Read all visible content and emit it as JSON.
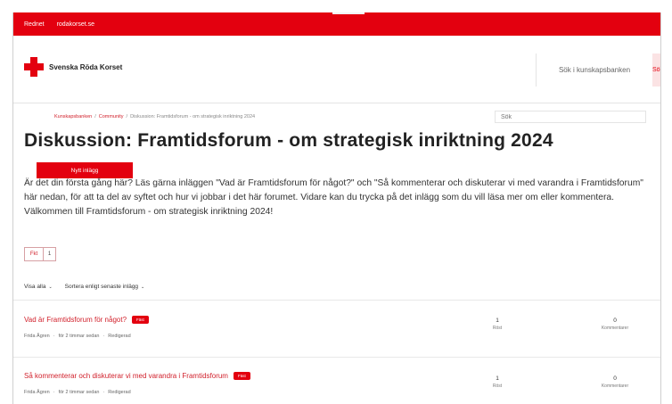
{
  "topbar": {
    "links": [
      "Rednet",
      "rodakorset.se"
    ],
    "color": "#e3000f"
  },
  "header": {
    "logo_text": "Svenska Röda Korset",
    "search_placeholder": "Sök i kunskapsbanken",
    "search_button": "Sök"
  },
  "breadcrumb": {
    "items": [
      "Kunskapsbanken",
      "Community",
      "Diskussion: Framtidsforum - om strategisk inriktning 2024"
    ],
    "separator": "/"
  },
  "side_search": {
    "placeholder": "Sök"
  },
  "page": {
    "title": "Diskussion: Framtidsforum - om strategisk inriktning 2024",
    "new_post_button": "Nytt inlägg",
    "intro": "Är det din första gång här? Läs gärna inläggen \"Vad är Framtidsforum för något?\" och \"Så kommenterar och diskuterar vi med varandra i Framtidsforum\" här nedan, för att ta del av syftet och hur vi jobbar i det här forumet. Vidare kan du trycka på det inlägg som du vill läsa mer om eller kommentera. Välkommen till Framtidsforum - om strategisk inriktning 2024!"
  },
  "pager": {
    "first_label": "Fkt",
    "page": "1"
  },
  "filters": {
    "show": "Visa alla",
    "sort": "Sortera enligt senaste inlägg"
  },
  "posts": [
    {
      "title": "Vad är Framtidsforum för något?",
      "badge": "Fäst",
      "author": "Frida Ågren",
      "time": "för 2 timmar sedan",
      "edited": "Redigerad",
      "sep": "·",
      "votes": "1",
      "votes_label": "Röst",
      "comments": "0",
      "comments_label": "Kommentarer"
    },
    {
      "title": "Så kommenterar och diskuterar vi med varandra i Framtidsforum",
      "badge": "Fäst",
      "author": "Frida Ågren",
      "time": "för 2 timmar sedan",
      "edited": "Redigerad",
      "sep": "·",
      "votes": "1",
      "votes_label": "Röst",
      "comments": "0",
      "comments_label": "Kommentarer"
    }
  ],
  "icons": {
    "chevron": "chevron-down-icon",
    "logo": "red-cross-icon"
  }
}
